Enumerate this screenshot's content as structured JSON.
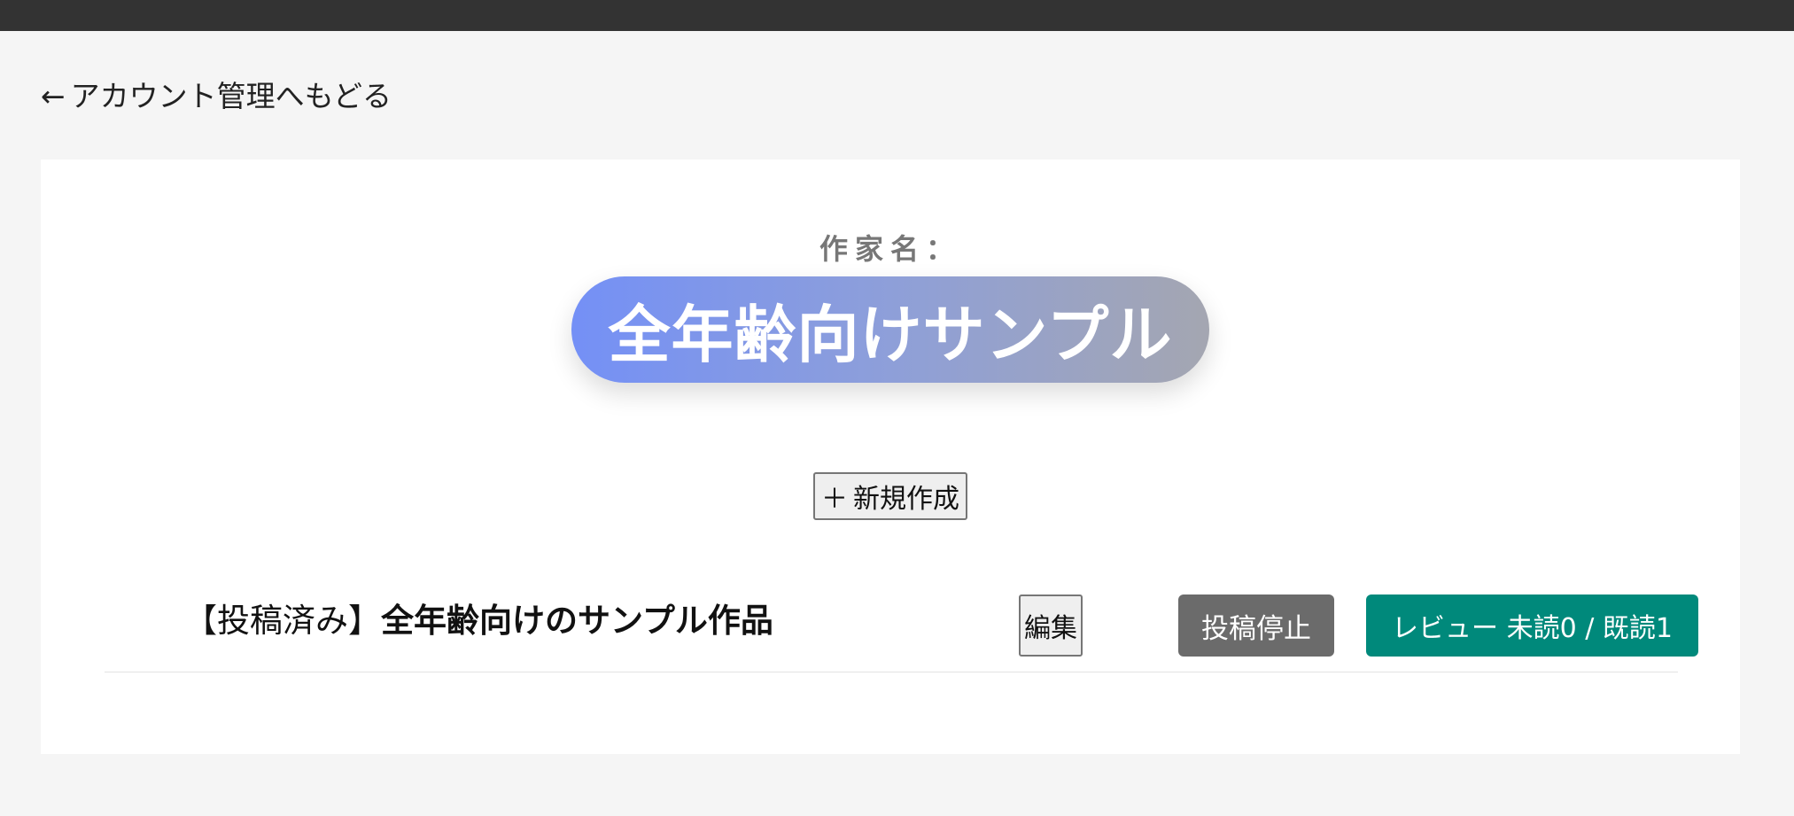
{
  "back_link": {
    "arrow": "←",
    "label": "アカウント管理へもどる"
  },
  "author": {
    "label": "作家名：",
    "name": "全年齢向けサンプル"
  },
  "new_button": {
    "plus": "＋",
    "label": "新規作成"
  },
  "works": [
    {
      "status": "【投稿済み】",
      "title": "全年齢向けのサンプル作品",
      "edit_label": "編集",
      "stop_label": "投稿停止",
      "review_label": "レビュー 未読0 / 既読1"
    }
  ],
  "colors": {
    "topbar": "#333333",
    "background": "#f5f5f5",
    "pill_gradient_start": "#7490f6",
    "pill_gradient_end": "#a4a6b1",
    "stop_button": "#6b6b6b",
    "review_button": "#00897b"
  }
}
